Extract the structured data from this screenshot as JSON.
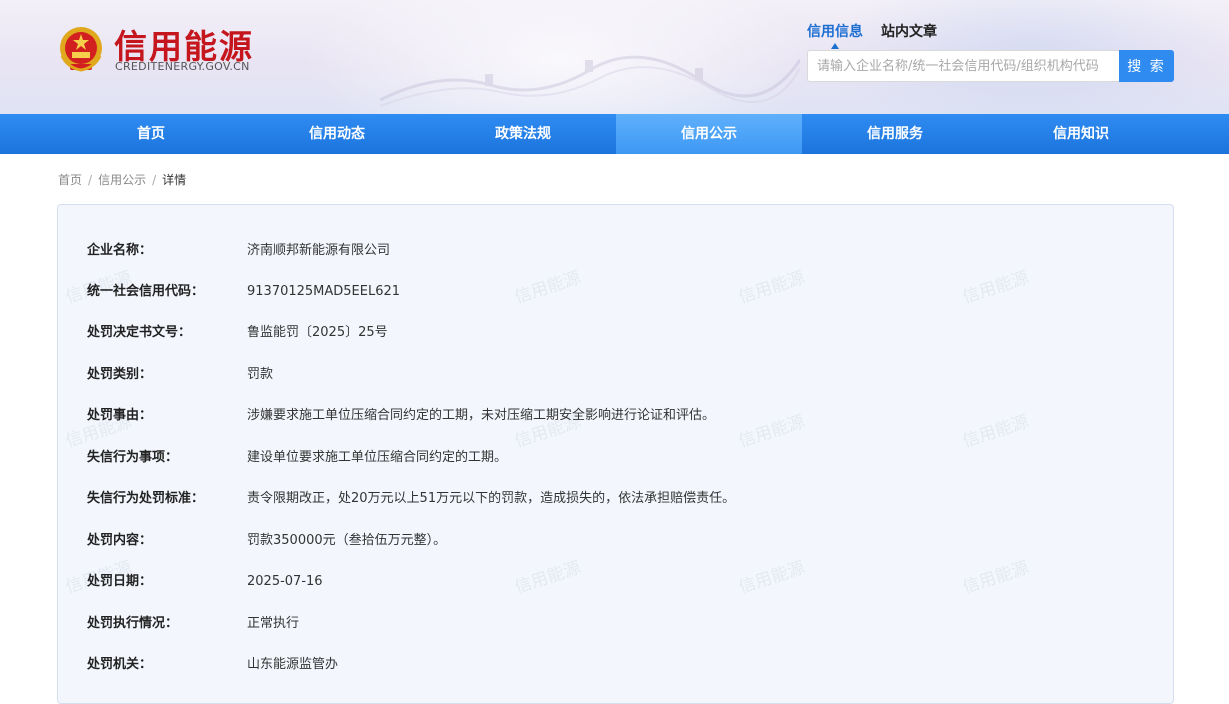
{
  "header": {
    "logo_title": "信用能源",
    "logo_subtitle": "CREDITENERGY.GOV.CN"
  },
  "search": {
    "tabs": [
      "信用信息",
      "站内文章"
    ],
    "active_tab": "信用信息",
    "placeholder": "请输入企业名称/统一社会信用代码/组织机构代码",
    "button_label": "搜 索"
  },
  "nav": {
    "items": [
      "首页",
      "信用动态",
      "政策法规",
      "信用公示",
      "信用服务",
      "信用知识"
    ],
    "active": "信用公示"
  },
  "breadcrumb": {
    "items": [
      "首页",
      "信用公示",
      "详情"
    ],
    "separator": "/"
  },
  "watermark_text": "信用能源",
  "detail": {
    "rows": [
      {
        "label": "企业名称：",
        "value": "济南顺邦新能源有限公司"
      },
      {
        "label": "统一社会信用代码：",
        "value": "91370125MAD5EEL621"
      },
      {
        "label": "处罚决定书文号：",
        "value": "鲁监能罚〔2025〕25号"
      },
      {
        "label": "处罚类别：",
        "value": "罚款"
      },
      {
        "label": "处罚事由：",
        "value": "涉嫌要求施工单位压缩合同约定的工期，未对压缩工期安全影响进行论证和评估。"
      },
      {
        "label": "失信行为事项：",
        "value": "建设单位要求施工单位压缩合同约定的工期。"
      },
      {
        "label": "失信行为处罚标准：",
        "value": "责令限期改正，处20万元以上51万元以下的罚款，造成损失的，依法承担赔偿责任。"
      },
      {
        "label": "处罚内容：",
        "value": "罚款350000元（叁拾伍万元整）。"
      },
      {
        "label": "处罚日期：",
        "value": "2025-07-16"
      },
      {
        "label": "处罚执行情况：",
        "value": "正常执行"
      },
      {
        "label": "处罚机关：",
        "value": "山东能源监管办"
      }
    ]
  },
  "colors": {
    "brand_red": "#c4161c",
    "nav_blue": "#1b74dc",
    "nav_active": "#3d98f4",
    "search_button": "#2f8bf0"
  }
}
